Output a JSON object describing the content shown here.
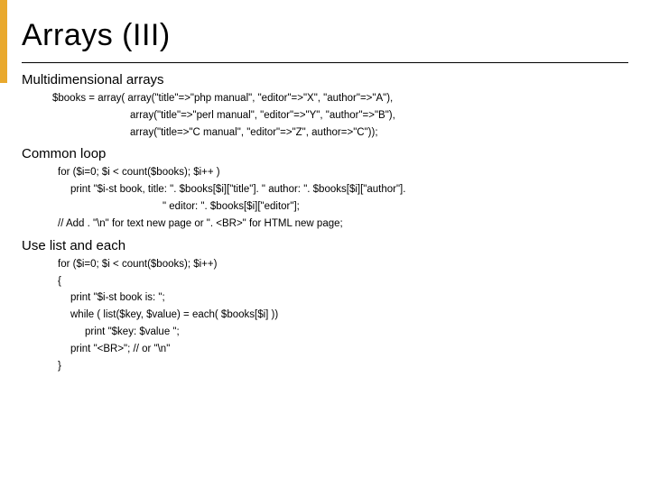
{
  "title": "Arrays (III)",
  "s1": {
    "heading": "Multidimensional arrays",
    "l1": "$books = array( array(\"title\"=>\"php manual\", \"editor\"=>\"X\", \"author\"=>\"A\"),",
    "l2": "array(\"title\"=>\"perl manual\", \"editor\"=>\"Y\", \"author\"=>\"B\"),",
    "l3": "array(\"title=>\"C manual\", \"editor\"=>\"Z\", author=>\"C\"));"
  },
  "s2": {
    "heading": "Common loop",
    "l1": "for ($i=0; $i < count($books); $i++ )",
    "l2": "print \"$i-st book, title: \". $books[$i][\"title\"]. \" author: \". $books[$i][\"author\"].",
    "l3": "\" editor: \". $books[$i][\"editor\"];",
    "l4": "// Add . \"\\n\" for text new page or \". <BR>\" for HTML new page;"
  },
  "s3": {
    "heading": "Use list and each",
    "l1": "for ($i=0; $i < count($books); $i++)",
    "l2": "{",
    "l3": "print \"$i-st book is: \";",
    "l4": "while ( list($key, $value) = each( $books[$i] ))",
    "l5": "print \"$key: $value \";",
    "l6": "print \"<BR>\"; // or \"\\n\"",
    "l7": "}"
  }
}
